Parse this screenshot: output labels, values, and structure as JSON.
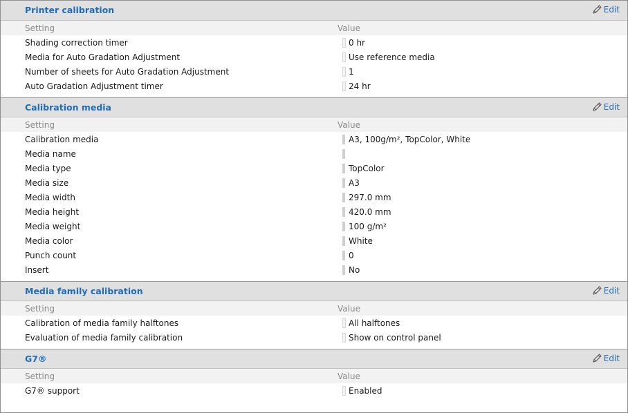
{
  "edit_label": "Edit",
  "col_setting": "Setting",
  "col_value": "Value",
  "sections": [
    {
      "title": "Printer calibration",
      "rows": [
        {
          "setting": "Shading correction timer",
          "value": "0 hr"
        },
        {
          "setting": "Media for Auto Gradation Adjustment",
          "value": "Use reference media"
        },
        {
          "setting": "Number of sheets for Auto Gradation Adjustment",
          "value": "1"
        },
        {
          "setting": "Auto Gradation Adjustment timer",
          "value": "24 hr"
        }
      ]
    },
    {
      "title": "Calibration media",
      "rows": [
        {
          "setting": "Calibration media",
          "value": "A3, 100g/m², TopColor, White"
        },
        {
          "setting": "Media name",
          "value": ""
        },
        {
          "setting": "Media type",
          "value": "TopColor"
        },
        {
          "setting": "Media size",
          "value": "A3"
        },
        {
          "setting": "Media width",
          "value": "297.0 mm"
        },
        {
          "setting": "Media height",
          "value": "420.0 mm"
        },
        {
          "setting": "Media weight",
          "value": "100 g/m²"
        },
        {
          "setting": "Media color",
          "value": "White"
        },
        {
          "setting": "Punch count",
          "value": "0"
        },
        {
          "setting": "Insert",
          "value": "No"
        }
      ]
    },
    {
      "title": "Media family calibration",
      "rows": [
        {
          "setting": "Calibration of media family halftones",
          "value": "All halftones"
        },
        {
          "setting": "Evaluation of media family calibration",
          "value": "Show on control panel"
        }
      ]
    },
    {
      "title": "G7®",
      "rows": [
        {
          "setting": "G7® support",
          "value": "Enabled"
        }
      ]
    }
  ]
}
